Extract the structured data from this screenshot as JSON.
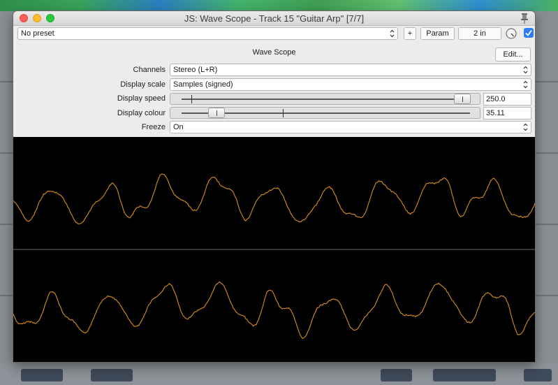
{
  "window": {
    "title": "JS: Wave Scope - Track 15 \"Guitar Arp\" [7/7]"
  },
  "toolbar": {
    "preset": "No preset",
    "add_label": "+",
    "param_label": "Param",
    "io_label": "2 in",
    "enabled": true
  },
  "plugin": {
    "name": "Wave Scope",
    "edit_label": "Edit..."
  },
  "params": {
    "channels": {
      "label": "Channels",
      "value": "Stereo (L+R)"
    },
    "display_scale": {
      "label": "Display scale",
      "value": "Samples (signed)"
    },
    "display_speed": {
      "label": "Display speed",
      "value": "250.0",
      "position": 0.97
    },
    "display_colour": {
      "label": "Display colour",
      "value": "35.11",
      "position": 0.13
    },
    "freeze": {
      "label": "Freeze",
      "value": "On"
    }
  },
  "scope": {
    "wave_color": "#d98e1a",
    "divider_color": "#6a6a6a",
    "background": "#000000"
  }
}
